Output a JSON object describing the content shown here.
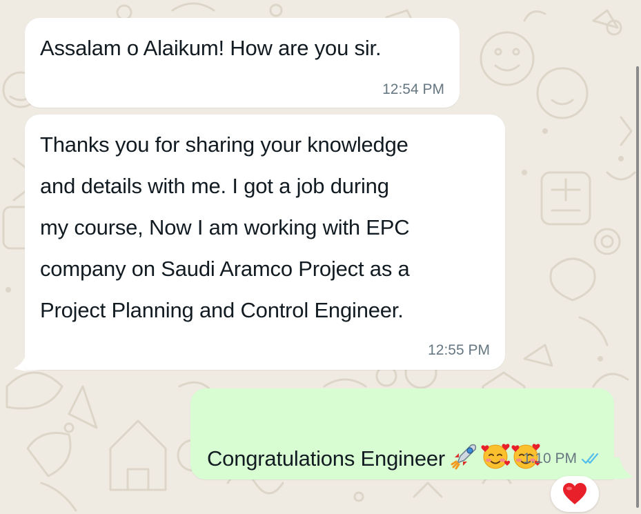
{
  "messages": [
    {
      "direction": "incoming",
      "text": "Assalam o Alaikum! How are you sir.",
      "time": "12:54 PM"
    },
    {
      "direction": "incoming",
      "text": "Thanks you for sharing your knowledge\nand details with me. I got a job during\nmy course, Now I am working with EPC\ncompany on Saudi Aramco Project as a\nProject Planning and Control Engineer.",
      "time": "12:55 PM"
    },
    {
      "direction": "outgoing",
      "text": "Congratulations Engineer",
      "emojis": [
        "rocket-emoji",
        "smiling-face-with-hearts-emoji",
        "smiling-face-with-hearts-emoji"
      ],
      "time": "1:10 PM",
      "status": "read-double-check-icon"
    }
  ],
  "reaction": {
    "emoji": "red-heart-emoji"
  },
  "colors": {
    "wallpaper": "#efeae2",
    "incoming_bubble": "#ffffff",
    "outgoing_bubble": "#d9fdd3",
    "text": "#111b21",
    "timestamp": "#667781",
    "read_ticks": "#53bdeb",
    "heart": "#e8202a"
  }
}
